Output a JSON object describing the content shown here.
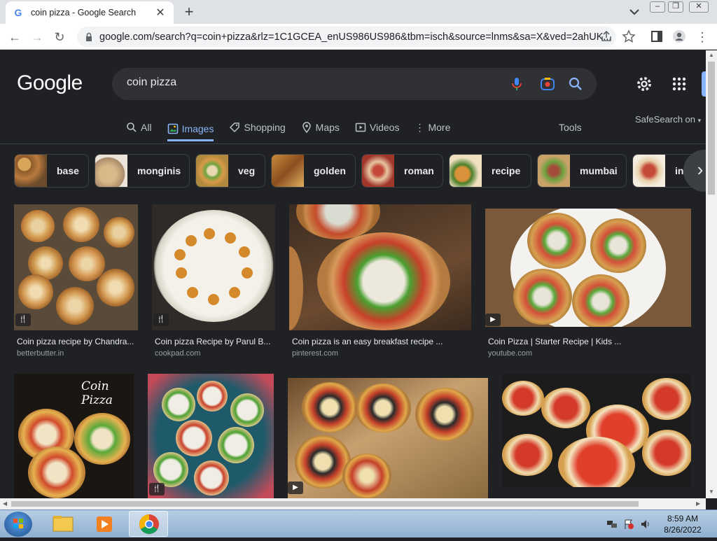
{
  "browser": {
    "tab_title": "coin pizza - Google Search",
    "new_tab": "+",
    "url": "google.com/search?q=coin+pizza&rlz=1C1GCEA_enUS986US986&tbm=isch&source=lnms&sa=X&ved=2ahUK..."
  },
  "google": {
    "logo": "Google",
    "query": "coin pizza",
    "nav": [
      "All",
      "Images",
      "Shopping",
      "Maps",
      "Videos",
      "More"
    ],
    "tools": "Tools",
    "safesearch": "SafeSearch on"
  },
  "chips": [
    "base",
    "monginis",
    "veg",
    "golden",
    "roman",
    "recipe",
    "mumbai",
    "in"
  ],
  "results": [
    {
      "caption": "Coin pizza recipe by Chandra...",
      "source": "betterbutter.in"
    },
    {
      "caption": "Coin pizza Recipe by Parul B...",
      "source": "cookpad.com"
    },
    {
      "caption": "Coin pizza is an easy breakfast recipe ...",
      "source": "pinterest.com"
    },
    {
      "caption": "Coin Pizza | Starter Recipe | Kids ...",
      "source": "youtube.com"
    }
  ],
  "image_text": {
    "coin_pizza_overlay": "Coin Pizza"
  },
  "taskbar": {
    "time": "8:59 AM",
    "date": "8/26/2022"
  },
  "colors": {
    "bg": "#202124",
    "accent": "#8ab4f8",
    "text": "#e8eaed",
    "muted": "#9aa0a6"
  }
}
